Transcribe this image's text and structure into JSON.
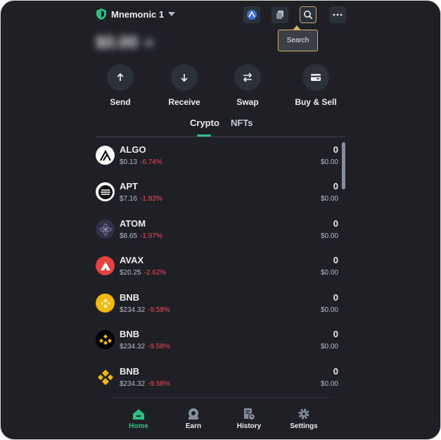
{
  "header": {
    "wallet_name": "Mnemonic 1",
    "tooltip": "Search"
  },
  "balance": "$0.00",
  "actions": [
    {
      "label": "Send",
      "icon": "arrow-up-icon"
    },
    {
      "label": "Receive",
      "icon": "arrow-down-icon"
    },
    {
      "label": "Swap",
      "icon": "swap-icon"
    },
    {
      "label": "Buy & Sell",
      "icon": "card-icon"
    }
  ],
  "tabs": [
    {
      "label": "Crypto",
      "active": true
    },
    {
      "label": "NFTs",
      "active": false
    }
  ],
  "assets": [
    {
      "symbol": "ALGO",
      "price": "$0.13",
      "change": "-6.74%",
      "balance": "0",
      "value": "$0.00",
      "icon": "algo-icon",
      "color": "#ffffff"
    },
    {
      "symbol": "APT",
      "price": "$7.16",
      "change": "-1.83%",
      "balance": "0",
      "value": "$0.00",
      "icon": "aptos-icon",
      "color": "#ffffff"
    },
    {
      "symbol": "ATOM",
      "price": "$8.65",
      "change": "-1.97%",
      "balance": "0",
      "value": "$0.00",
      "icon": "cosmos-icon",
      "color": "#2e3148"
    },
    {
      "symbol": "AVAX",
      "price": "$20.25",
      "change": "-2.62%",
      "balance": "0",
      "value": "$0.00",
      "icon": "avax-icon",
      "color": "#e84142"
    },
    {
      "symbol": "BNB",
      "price": "$234.32",
      "change": "-9.58%",
      "balance": "0",
      "value": "$0.00",
      "icon": "bnb-icon",
      "color": "#f0b90b"
    },
    {
      "symbol": "BNB",
      "price": "$234.32",
      "change": "-9.58%",
      "balance": "0",
      "value": "$0.00",
      "icon": "bnb-icon",
      "color": "#000000"
    },
    {
      "symbol": "BNB",
      "price": "$234.32",
      "change": "-9.58%",
      "balance": "0",
      "value": "$0.00",
      "icon": "bnb-icon",
      "color": "#1e2026"
    }
  ],
  "nav": [
    {
      "label": "Home",
      "icon": "home-icon",
      "active": true
    },
    {
      "label": "Earn",
      "icon": "earn-icon",
      "active": false
    },
    {
      "label": "History",
      "icon": "history-icon",
      "active": false
    },
    {
      "label": "Settings",
      "icon": "gear-icon",
      "active": false
    }
  ],
  "colors": {
    "background": "#1e2026",
    "accent": "#2ebd85",
    "negative": "#f6465d",
    "tooltip_border": "#d9b36c"
  }
}
